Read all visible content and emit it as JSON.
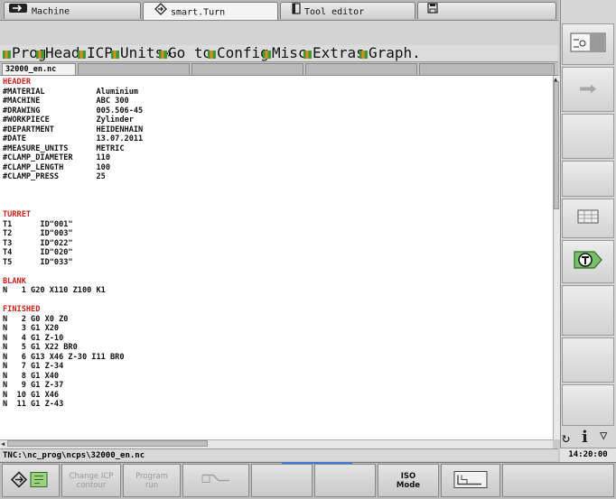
{
  "tabs": [
    {
      "label": "Machine",
      "icon": "arrow-right-icon"
    },
    {
      "label": "smart.Turn",
      "icon": "workflow-icon"
    },
    {
      "label": "Tool editor",
      "icon": "tool-holder-icon"
    },
    {
      "label": "",
      "icon": "floppy-icon"
    }
  ],
  "menu": [
    "Prog",
    "Head",
    "ICP",
    "Units»",
    "Go to",
    "Config",
    "Misc",
    "Extras",
    "Graph."
  ],
  "file_tab": "32000_en.nc",
  "program_lines": [
    {
      "text": "HEADER",
      "red": true
    },
    {
      "text": "#MATERIAL           Aluminium"
    },
    {
      "text": "#MACHINE            ABC 300"
    },
    {
      "text": "#DRAWING            005.506-45"
    },
    {
      "text": "#WORKPIECE          Zylinder"
    },
    {
      "text": "#DEPARTMENT         HEIDENHAIN"
    },
    {
      "text": "#DATE               13.07.2011"
    },
    {
      "text": "#MEASURE_UNITS      METRIC"
    },
    {
      "text": "#CLAMP_DIAMETER     110"
    },
    {
      "text": "#CLAMP_LENGTH       100"
    },
    {
      "text": "#CLAMP_PRESS        25"
    },
    {
      "text": ""
    },
    {
      "text": ""
    },
    {
      "text": ""
    },
    {
      "text": "TURRET",
      "red": true
    },
    {
      "text": "T1      ID\"001\""
    },
    {
      "text": "T2      ID\"003\""
    },
    {
      "text": "T3      ID\"022\""
    },
    {
      "text": "T4      ID\"020\""
    },
    {
      "text": "T5      ID\"033\""
    },
    {
      "text": ""
    },
    {
      "text": "BLANK",
      "red": true
    },
    {
      "text": "N   1 G20 X110 Z100 K1"
    },
    {
      "text": ""
    },
    {
      "text": "FINISHED",
      "red": true
    },
    {
      "text": "N   2 G0 X0 Z0"
    },
    {
      "text": "N   3 G1 X20"
    },
    {
      "text": "N   4 G1 Z-10"
    },
    {
      "text": "N   5 G1 X22 BR0"
    },
    {
      "text": "N   6 G13 X46 Z-30 I11 BR0"
    },
    {
      "text": "N   7 G1 Z-34"
    },
    {
      "text": "N   8 G1 X40"
    },
    {
      "text": "N   9 G1 Z-37"
    },
    {
      "text": "N  10 G1 X46"
    },
    {
      "text": "N  11 G1 Z-43"
    }
  ],
  "status_path": "TNC:\\nc_prog\\ncps\\32000_en.nc",
  "clock": "14:20:00",
  "right_softkeys": [
    {
      "icon": "machine-icon"
    },
    {
      "icon": "arrow-right-icon"
    },
    {
      "icon": ""
    },
    {
      "icon": ""
    },
    {
      "icon": "table-icon"
    },
    {
      "icon": "tool-table-icon"
    },
    {
      "icon": ""
    },
    {
      "icon": ""
    },
    {
      "icon": ""
    }
  ],
  "bottom_softkeys": [
    {
      "label": "",
      "icon": "workflow-icon"
    },
    {
      "label": "Change ICP contour"
    },
    {
      "label": "Program run"
    },
    {
      "label": "",
      "icon": "tool-icon"
    },
    {
      "label": ""
    },
    {
      "label": ""
    },
    {
      "label": "ISO Mode"
    },
    {
      "label": "",
      "icon": "contour-icon"
    },
    {
      "label": ""
    }
  ],
  "colors": {
    "accent": "#3a7bd5",
    "header_red": "#d0221c",
    "menu_green": "#3a9a3a"
  }
}
